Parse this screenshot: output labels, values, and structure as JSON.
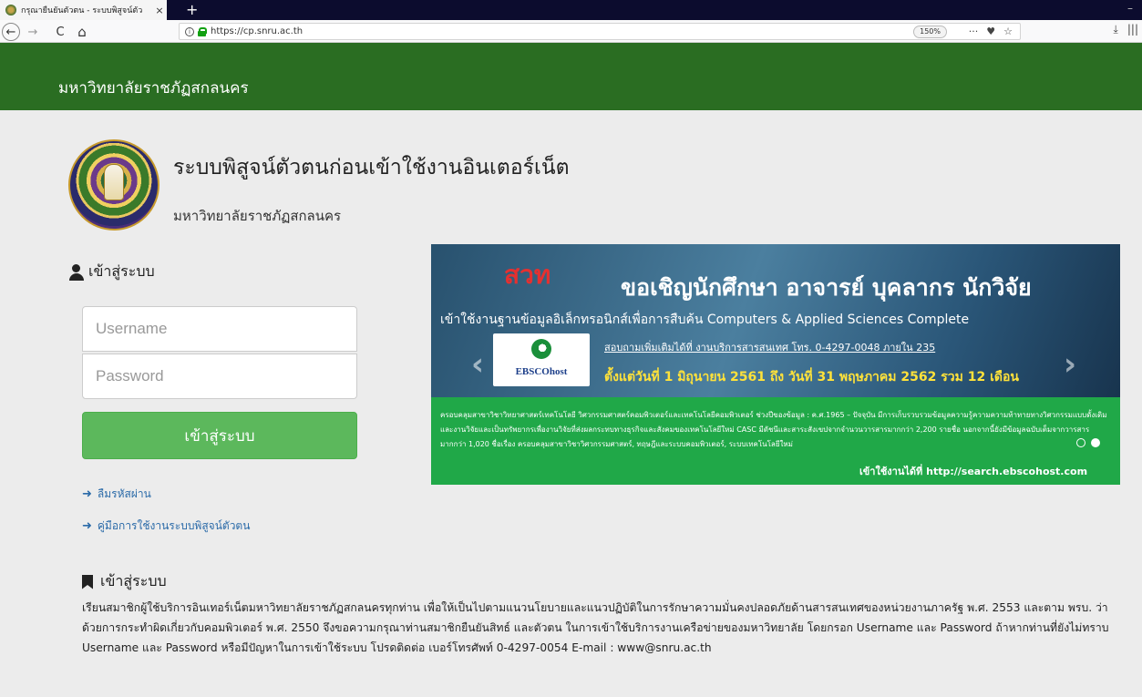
{
  "browser": {
    "tab_title": "กรุณายืนยันตัวตน - ระบบพิสูจน์ตัว",
    "tab_close": "×",
    "new_tab": "+",
    "minimize": "–",
    "back": "←",
    "forward": "→",
    "reload": "C",
    "home": "⌂",
    "url": "https://cp.snru.ac.th",
    "zoom": "150%",
    "menu": "···",
    "pocket": "♥",
    "bookmark_star": "☆",
    "download": "⤓",
    "library": "|||"
  },
  "header": {
    "site_name": "มหาวิทยาลัยราชภัฏสกลนคร"
  },
  "page": {
    "title": "ระบบพิสูจน์ตัวตนก่อนเข้าใช้งานอินเตอร์เน็ต",
    "subtitle": "มหาวิทยาลัยราชภัฏสกลนคร"
  },
  "login": {
    "heading": "เข้าสู่ระบบ",
    "username_placeholder": "Username",
    "password_placeholder": "Password",
    "submit_label": "เข้าสู่ระบบ",
    "forgot_password": "ลืมรหัสผ่าน",
    "manual": "คู่มือการใช้งานระบบพิสูจน์ตัวตน"
  },
  "banner": {
    "logo": "สวท",
    "headline": "ขอเชิญนักศึกษา อาจารย์ บุคลากร นักวิจัย",
    "database_line": "เข้าใช้งานฐานข้อมูลอิเล็กทรอนิกส์เพื่อการสืบค้น Computers & Applied Sciences Complete",
    "contact": "สอบถามเพิ่มเติมได้ที่ งานบริการสารสนเทศ โทร. 0-4297-0048 ภายใน 235",
    "date_range": "ตั้งแต่วันที่ 1 มิถุนายน 2561 ถึง วันที่ 31 พฤษภาคม 2562 รวม 12 เดือน",
    "ebsco": "EBSCOhost",
    "description": "ครอบคลุมสาขาวิชาวิทยาศาสตร์เทคโนโลยี วิศวกรรมศาสตร์คอมพิวเตอร์และเทคโนโลยีคอมพิวเตอร์ ช่วงปีของข้อมูล : ค.ศ.1965 – ปัจจุบัน มีการเก็บรวบรวมข้อมูลความรู้ความความท้าทายทางวิศวกรรมแบบดั้งเดิมและงานวิจัยและเป็นทรัพยากรเพื่องานวิจัยที่ส่งผลกระทบทางธุรกิจและสังคมของเทคโนโลยีใหม่ CASC มีดัชนีและสาระสังเขปจากจำนวนวารสารมากกว่า 2,200 รายชื่อ นอกจากนี้ยังมีข้อมูลฉบับเต็มจากวารสารมากกว่า 1,020 ชื่อเรื่อง ครอบคลุมสาขาวิชาวิศวกรรมศาสตร์, ทฤษฎีและระบบคอมพิวเตอร์, ระบบเทคโนโลยีใหม่",
    "access": "เข้าใช้งานได้ที่ http://search.ebscohost.com",
    "prev": "‹",
    "next": "›"
  },
  "info": {
    "heading": "เข้าสู่ระบบ",
    "text": "เรียนสมาชิกผู้ใช้บริการอินเทอร์เน็ตมหาวิทยาลัยราชภัฏสกลนครทุกท่าน เพื่อให้เป็นไปตามแนวนโยบายและแนวปฏิบัติในการรักษาความมั่นคงปลอดภัยด้านสารสนเทศของหน่วยงานภาครัฐ พ.ศ. 2553 และตาม พรบ. ว่าด้วยการกระทำผิดเกี่ยวกับคอมพิวเตอร์ พ.ศ. 2550 จึงขอความกรุณาท่านสมาชิกยืนยันสิทธ์ และตัวตน ในการเข้าใช้บริการงานเครือข่ายของมหาวิทยาลัย โดยกรอก Username และ Password ถ้าหากท่านที่ยังไม่ทราบ Username และ Password หรือมีปัญหาในการเข้าใช้ระบบ โปรดติดต่อ เบอร์โทรศัพท์ 0-4297-0054 E-mail : www@snru.ac.th"
  }
}
